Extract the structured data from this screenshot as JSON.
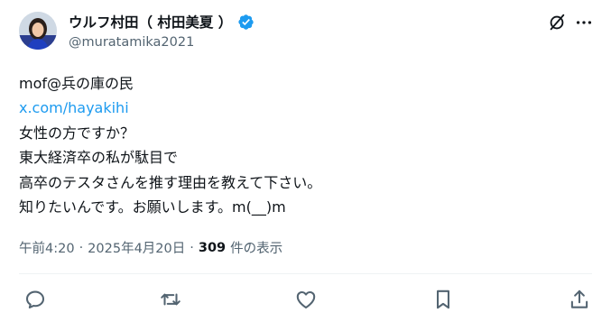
{
  "author": {
    "display_name": "ウルフ村田（ 村田美夏 ）",
    "handle": "@muratamika2021",
    "verified": true
  },
  "tweet": {
    "lines": [
      "mof@兵の庫の民",
      "x.com/hayakihi",
      "女性の方ですか？",
      "東大経済卒の私が駄目で",
      "高卒のテスタさんを推す理由を教えて下さい。",
      "知りたいんです。お願いします。m(__)m"
    ]
  },
  "meta": {
    "time": "午前4:20",
    "date": "2025年4月20日",
    "separator": "·",
    "views_count": "309",
    "views_label": "件の表示"
  },
  "icons": {
    "verified": "verified-badge-icon",
    "grok": "grok-icon",
    "more": "more-options-icon",
    "reply": "reply-icon",
    "retweet": "retweet-icon",
    "like": "like-icon",
    "bookmark": "bookmark-icon",
    "share": "share-icon"
  },
  "colors": {
    "link": "#1d9bf0",
    "verified": "#1d9bf0",
    "secondary_text": "#536471",
    "primary_text": "#0f1419"
  }
}
